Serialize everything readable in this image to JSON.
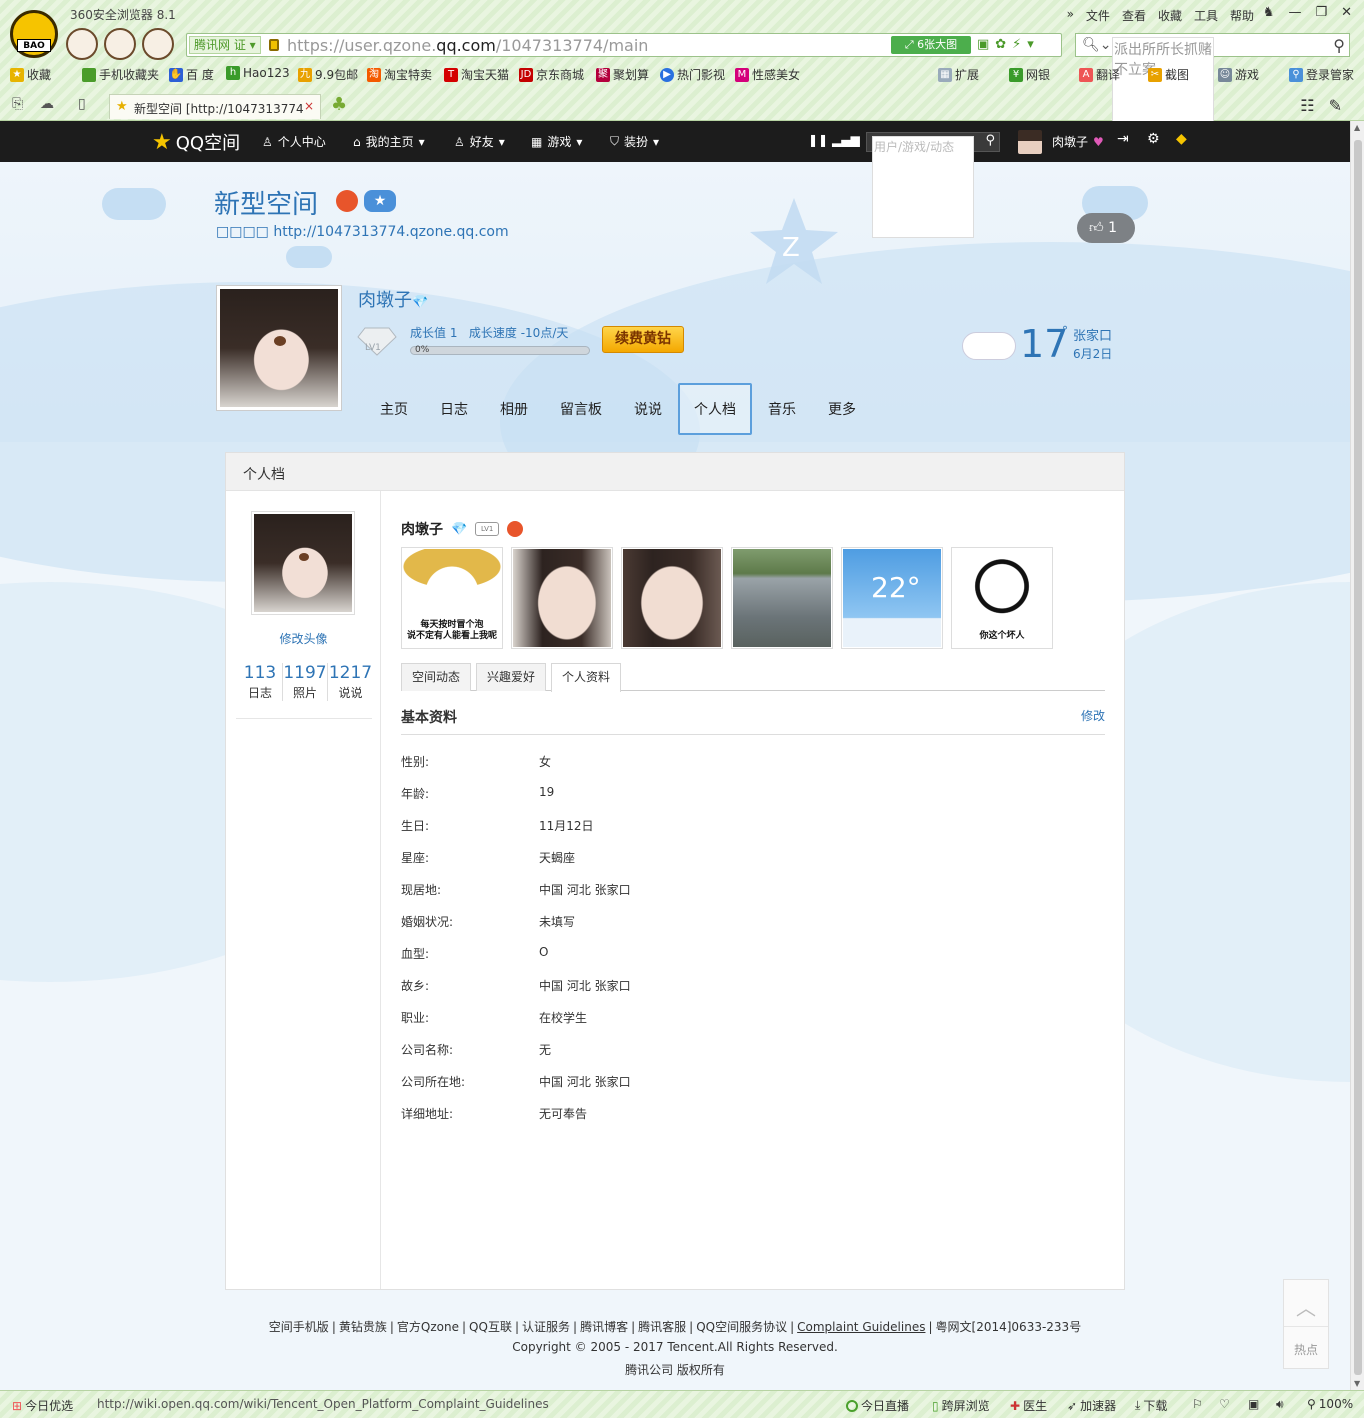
{
  "browser": {
    "app_title": "360安全浏览器 8.1",
    "menu": [
      "文件",
      "查看",
      "收藏",
      "工具",
      "帮助"
    ],
    "address": {
      "badge": "腾讯网",
      "badge_cert": "证",
      "url_prefix": "https://user.qzone.",
      "url_domain": "qq.com",
      "url_suffix": "/1047313774/main",
      "big_image_label": "6张大图"
    },
    "search_placeholder": "派出所所长抓赌不立案",
    "favorites": [
      "收藏",
      "手机收藏夹",
      "百 度",
      "Hao123",
      "9.9包邮",
      "淘宝特卖",
      "淘宝天猫",
      "京东商城",
      "聚划算",
      "热门影视",
      "性感美女"
    ],
    "favorites_right": [
      "扩展",
      "网银",
      "翻译",
      "截图",
      "游戏",
      "登录管家"
    ],
    "tab": {
      "title": "新型空间 [http://1047313774.",
      "close": "×"
    }
  },
  "qzone_nav": {
    "logo_text": "QQ空间",
    "items": [
      "个人中心",
      "我的主页",
      "好友",
      "游戏",
      "装扮"
    ],
    "search_placeholder": "用户/游戏/动态",
    "user_name": "肉墩子"
  },
  "header": {
    "space_title": "新型空间",
    "space_url": "□□□□ http://1047313774.qzone.qq.com",
    "like_count": "1",
    "nickname": "肉墩子",
    "level_badge": "LV1",
    "growth_value": "成长值 1",
    "growth_speed": "成长速度 -10点/天",
    "progress_percent": 0,
    "progress_label": "0%",
    "renew_button": "续费黄钻",
    "weather": {
      "temp": "17",
      "deg": "°",
      "city": "张家口",
      "date": "6月2日"
    },
    "tabs": [
      "主页",
      "日志",
      "相册",
      "留言板",
      "说说",
      "个人档",
      "音乐",
      "更多"
    ],
    "active_tab": "个人档"
  },
  "panel": {
    "title": "个人档",
    "edit_avatar": "修改头像",
    "stats": [
      {
        "num": "113",
        "label": "日志"
      },
      {
        "num": "1197",
        "label": "照片"
      },
      {
        "num": "1217",
        "label": "说说"
      }
    ],
    "nickname": "肉墩子",
    "photos": [
      {
        "caption": "每天按时冒个泡\n说不定有人能看上我呢"
      },
      {
        "caption": ""
      },
      {
        "caption": ""
      },
      {
        "caption": ""
      },
      {
        "caption": "22°"
      },
      {
        "caption": "你这个坏人"
      }
    ],
    "sub_tabs": [
      "空间动态",
      "兴趣爱好",
      "个人资料"
    ],
    "active_sub_tab": "个人资料",
    "section_title": "基本资料",
    "section_edit": "修改",
    "info": [
      {
        "k": "性别:",
        "v": "女"
      },
      {
        "k": "年龄:",
        "v": "19"
      },
      {
        "k": "生日:",
        "v": "11月12日"
      },
      {
        "k": "星座:",
        "v": "天蝎座"
      },
      {
        "k": "现居地:",
        "v": "中国 河北 张家口"
      },
      {
        "k": "婚姻状况:",
        "v": "未填写"
      },
      {
        "k": "血型:",
        "v": "O"
      },
      {
        "k": "故乡:",
        "v": "中国 河北 张家口"
      },
      {
        "k": "职业:",
        "v": "在校学生"
      },
      {
        "k": "公司名称:",
        "v": "无"
      },
      {
        "k": "公司所在地:",
        "v": "中国 河北 张家口"
      },
      {
        "k": "详细地址:",
        "v": "无可奉告"
      }
    ]
  },
  "footer": {
    "links": [
      "空间手机版",
      "黄钻贵族",
      "官方Qzone",
      "QQ互联",
      "认证服务",
      "腾讯博客",
      "腾讯客服",
      "QQ空间服务协议",
      "Complaint Guidelines",
      "粤网文[2014]0633-233号"
    ],
    "copyright": "Copyright © 2005 - 2017 Tencent.All Rights Reserved.",
    "rights": "腾讯公司 版权所有",
    "hot_label": "热点"
  },
  "statusbar": {
    "today": "今日优选",
    "url": "http://wiki.open.qq.com/wiki/Tencent_Open_Platform_Complaint_Guidelines",
    "items": [
      "今日直播",
      "跨屏浏览",
      "医生",
      "加速器",
      "下载"
    ],
    "zoom": "100%"
  },
  "colors": {
    "accent": "#2e74b5",
    "nav_bg": "#1c1c1c",
    "renew": "#f4a800"
  }
}
